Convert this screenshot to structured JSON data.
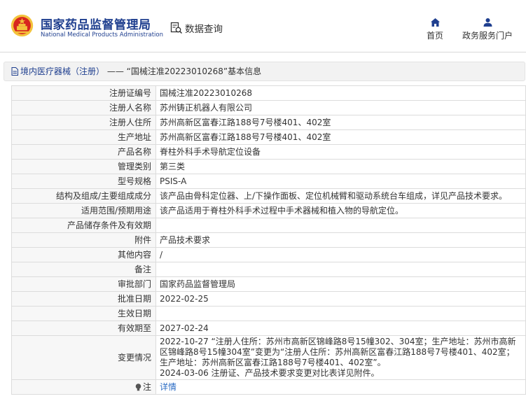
{
  "header": {
    "brand_cn": "国家药品监督管理局",
    "brand_en": "National Medical Products Administration",
    "search_label": "数据查询",
    "nav": [
      {
        "label": "首页",
        "icon": "home-icon"
      },
      {
        "label": "政务服务门户",
        "icon": "user-icon"
      }
    ]
  },
  "breadcrumb": {
    "link": "境内医疗器械（注册）",
    "separator": "——",
    "current": "“国械注准20223010268”基本信息"
  },
  "fields": [
    {
      "key": "注册证编号",
      "value": "国械注准20223010268"
    },
    {
      "key": "注册人名称",
      "value": "苏州铸正机器人有限公司"
    },
    {
      "key": "注册人住所",
      "value": "苏州高新区富春江路188号7号楼401、402室"
    },
    {
      "key": "生产地址",
      "value": "苏州高新区富春江路188号7号楼401、402室"
    },
    {
      "key": "产品名称",
      "value": "脊柱外科手术导航定位设备"
    },
    {
      "key": "管理类别",
      "value": "第三类"
    },
    {
      "key": "型号规格",
      "value": "PSIS-A"
    },
    {
      "key": "结构及组成/主要组成成分",
      "value": "该产品由骨科定位器、上/下操作面板、定位机械臂和驱动系统台车组成，详见产品技术要求。"
    },
    {
      "key": "适用范围/预期用途",
      "value": "该产品适用于脊柱外科手术过程中手术器械和植入物的导航定位。"
    },
    {
      "key": "产品储存条件及有效期",
      "value": ""
    },
    {
      "key": "附件",
      "value": "产品技术要求"
    },
    {
      "key": "其他内容",
      "value": "/"
    },
    {
      "key": "备注",
      "value": ""
    },
    {
      "key": "审批部门",
      "value": "国家药品监督管理局"
    },
    {
      "key": "批准日期",
      "value": "2022-02-25"
    },
    {
      "key": "生效日期",
      "value": ""
    },
    {
      "key": "有效期至",
      "value": "2027-02-24"
    }
  ],
  "change": {
    "key": "变更情况",
    "lines": [
      "2022-10-27 “注册人住所：苏州市高新区锦峰路8号15幢302、304室；生产地址：苏州市高新区锦峰路8号15幢304室”变更为“注册人住所：苏州高新区富春江路188号7号楼401、402室；生产地址：苏州高新区富春江路188号7号楼401、402室”。",
      "2024-03-06 注册证、产品技术要求变更对比表详见附件。"
    ]
  },
  "note": {
    "key": "注",
    "link": "详情"
  },
  "colors": {
    "brand_blue": "#1f3f8f",
    "link_blue": "#2b6cc4",
    "emblem_red": "#d7261e",
    "emblem_gold": "#f3c33c"
  }
}
